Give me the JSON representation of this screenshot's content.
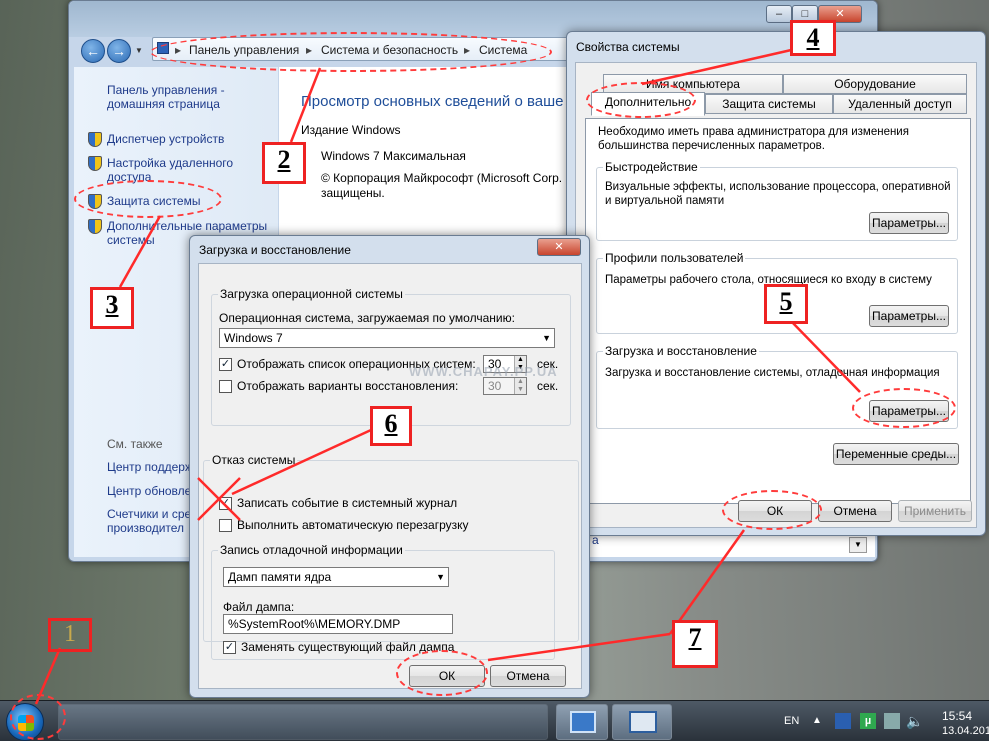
{
  "control_panel": {
    "breadcrumb": [
      "Панель управления",
      "Система и безопасность",
      "Система"
    ],
    "sidebar": {
      "home": "Панель управления - домашняя страница",
      "links": [
        "Диспетчер устройств",
        "Настройка удаленного доступа",
        "Защита системы",
        "Дополнительные параметры системы"
      ],
      "see_also": "См. также",
      "see_also_links": [
        "Центр поддерж",
        "Центр обновле",
        "Счетчики и сре",
        "производител"
      ]
    },
    "main": {
      "title": "Просмотр основных сведений о ваше",
      "edition_heading": "Издание Windows",
      "edition": "Windows 7 Максимальная",
      "copyright": "© Корпорация Майкрософт (Microsoft Corp.",
      "copyright2": "защищены.",
      "partial": "а"
    }
  },
  "system_properties": {
    "title": "Свойства системы",
    "tabs_row1": [
      "Имя компьютера",
      "Оборудование"
    ],
    "tabs_row2": [
      "Дополнительно",
      "Защита системы",
      "Удаленный доступ"
    ],
    "admin_note": "Необходимо иметь права администратора для изменения большинства перечисленных параметров.",
    "performance": {
      "label": "Быстродействие",
      "text": "Визуальные эффекты, использование процессора, оперативной и виртуальной памяти",
      "button": "Параметры..."
    },
    "profiles": {
      "label": "Профили пользователей",
      "text": "Параметры рабочего стола, относящиеся ко входу в систему",
      "button": "Параметры..."
    },
    "startup": {
      "label": "Загрузка и восстановление",
      "text": "Загрузка и восстановление системы, отладочная информация",
      "button": "Параметры..."
    },
    "env_button": "Переменные среды...",
    "ok": "ОК",
    "cancel": "Отмена",
    "apply": "Применить"
  },
  "boot_recovery": {
    "title": "Загрузка и восстановление",
    "os_group": "Загрузка операционной системы",
    "default_os_label": "Операционная система, загружаемая по умолчанию:",
    "default_os": "Windows 7",
    "show_list": "Отображать список операционных систем:",
    "show_list_value": "30",
    "show_recovery": "Отображать варианты восстановления:",
    "show_recovery_value": "30",
    "sec": "сек.",
    "failure_group": "Отказ системы",
    "write_event": "Записать событие в системный журнал",
    "auto_restart": "Выполнить автоматическую перезагрузку",
    "debug_group": "Запись отладочной информации",
    "dump_type": "Дамп памяти ядра",
    "dump_file_label": "Файл дампа:",
    "dump_file": "%SystemRoot%\\MEMORY.DMP",
    "overwrite": "Заменять существующий файл дампа",
    "ok": "ОК",
    "cancel": "Отмена"
  },
  "watermark": "WWW.CHAPAY.PP.UA",
  "annotations": [
    "1",
    "2",
    "3",
    "4",
    "5",
    "6",
    "7"
  ],
  "taskbar": {
    "lang": "EN",
    "time": "15:54",
    "date": "13.04.201"
  },
  "colors": {
    "annotation_red": "#ff2a2a",
    "link_blue": "#1e3a8a",
    "title_blue": "#1f4e99"
  }
}
